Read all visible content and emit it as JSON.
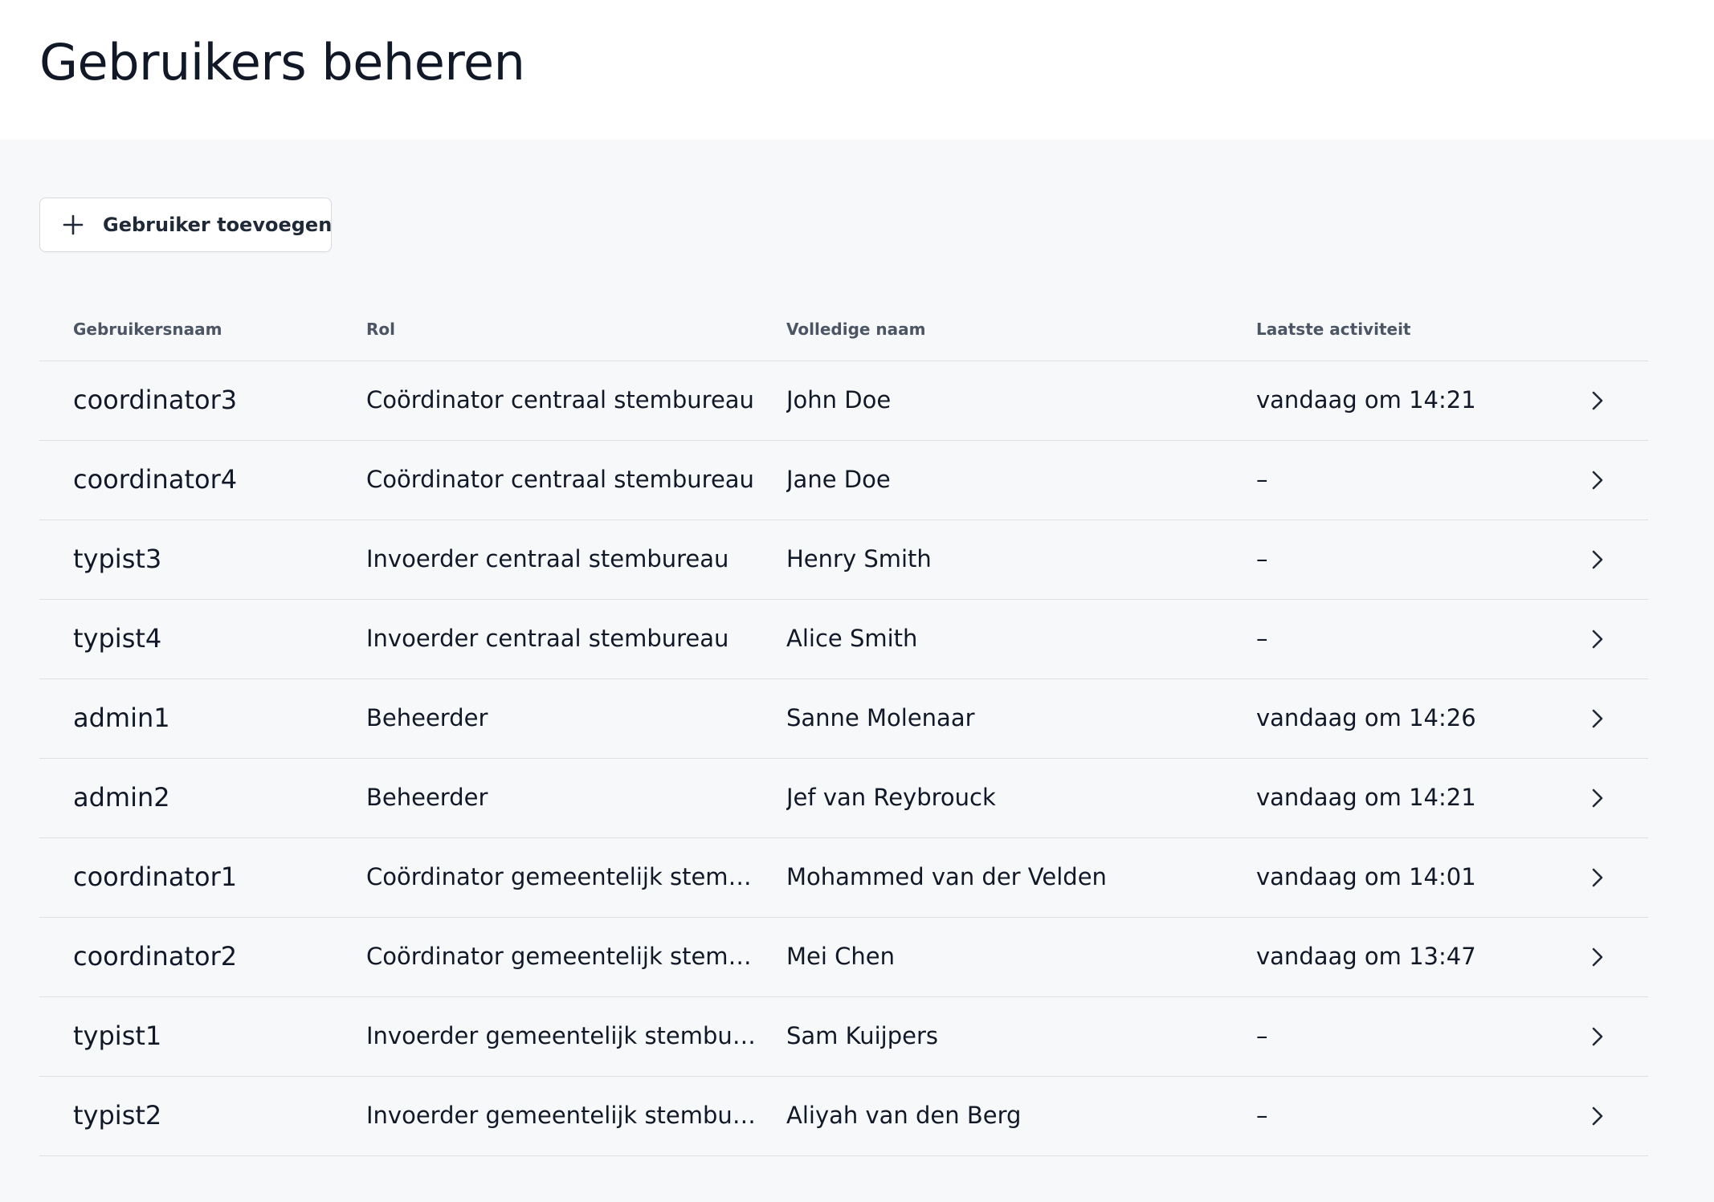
{
  "page": {
    "title": "Gebruikers beheren"
  },
  "toolbar": {
    "add_user_label": "Gebruiker toevoegen",
    "add_user_icon": "plus-icon"
  },
  "table": {
    "columns": {
      "username": "Gebruikersnaam",
      "role": "Rol",
      "fullname": "Volledige naam",
      "last_activity": "Laatste activiteit"
    },
    "rows": [
      {
        "username": "coordinator3",
        "role": "Coördinator centraal stembureau",
        "fullname": "John Doe",
        "last_activity": "vandaag om 14:21"
      },
      {
        "username": "coordinator4",
        "role": "Coördinator centraal stembureau",
        "fullname": "Jane Doe",
        "last_activity": "–"
      },
      {
        "username": "typist3",
        "role": "Invoerder centraal stembureau",
        "fullname": "Henry Smith",
        "last_activity": "–"
      },
      {
        "username": "typist4",
        "role": "Invoerder centraal stembureau",
        "fullname": "Alice Smith",
        "last_activity": "–"
      },
      {
        "username": "admin1",
        "role": "Beheerder",
        "fullname": "Sanne Molenaar",
        "last_activity": "vandaag om 14:26"
      },
      {
        "username": "admin2",
        "role": "Beheerder",
        "fullname": "Jef van Reybrouck",
        "last_activity": "vandaag om 14:21"
      },
      {
        "username": "coordinator1",
        "role": "Coördinator gemeentelijk stemb...",
        "fullname": "Mohammed van der Velden",
        "last_activity": "vandaag om 14:01"
      },
      {
        "username": "coordinator2",
        "role": "Coördinator gemeentelijk stemb...",
        "fullname": "Mei Chen",
        "last_activity": "vandaag om 13:47"
      },
      {
        "username": "typist1",
        "role": "Invoerder gemeentelijk stembur...",
        "fullname": "Sam Kuijpers",
        "last_activity": "–"
      },
      {
        "username": "typist2",
        "role": "Invoerder gemeentelijk stembur...",
        "fullname": "Aliyah van den Berg",
        "last_activity": "–"
      }
    ]
  },
  "colors": {
    "header_bg": "#ffffff",
    "page_bg": "#f7f8fa",
    "text": "#111827",
    "header_text": "#4b5563",
    "divider": "#dcdfe4"
  }
}
